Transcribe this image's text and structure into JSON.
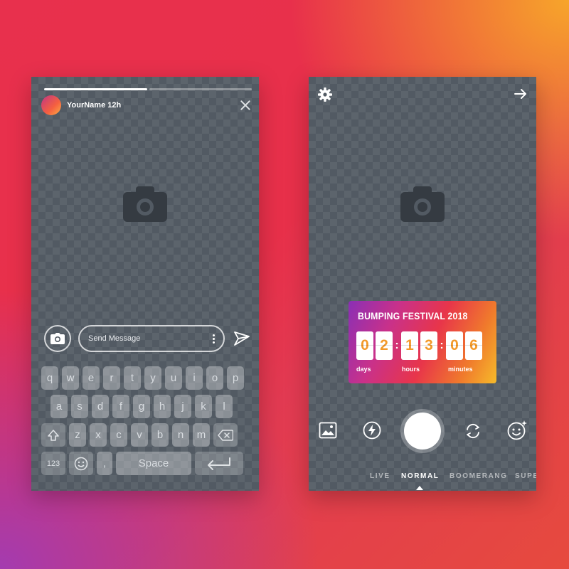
{
  "story": {
    "username": "YourName 12h",
    "progress_segments": [
      {
        "filled": 1
      },
      {
        "filled": 0
      }
    ],
    "message_placeholder": "Send Message"
  },
  "keyboard": {
    "row1": [
      "q",
      "w",
      "e",
      "r",
      "t",
      "y",
      "u",
      "i",
      "o",
      "p"
    ],
    "row2": [
      "a",
      "s",
      "d",
      "f",
      "g",
      "h",
      "j",
      "k",
      "l"
    ],
    "row3": [
      "z",
      "x",
      "c",
      "v",
      "b",
      "n",
      "m"
    ],
    "numbers_label": "123",
    "comma_label": ",",
    "space_label": "Space"
  },
  "camera": {
    "sticker": {
      "title": "BUMPING FESTIVAL 2018",
      "days": [
        "0",
        "2"
      ],
      "hours": [
        "1",
        "3"
      ],
      "minutes": [
        "0",
        "6"
      ],
      "days_label": "days",
      "hours_label": "hours",
      "minutes_label": "minutes"
    },
    "modes": [
      "LIVE",
      "NORMAL",
      "BOOMERANG",
      "SUPE"
    ],
    "active_mode": "NORMAL"
  },
  "icons": {
    "close": "close-icon",
    "camera": "camera-icon",
    "more": "more-vertical-icon",
    "send": "send-icon",
    "shift": "shift-icon",
    "backspace": "backspace-icon",
    "emoji": "emoji-icon",
    "return": "return-icon",
    "settings": "gear-icon",
    "next": "arrow-right-icon",
    "gallery": "gallery-icon",
    "flash": "flash-icon",
    "flip": "flip-camera-icon",
    "face_effects": "face-effects-icon"
  },
  "colors": {
    "panel": "#525a63",
    "placeholder_icon": "#353b42",
    "sticker_gradient": [
      "#8a2fb5",
      "#e8354a",
      "#f6bb2a"
    ],
    "digit_text": "#f39a2a"
  }
}
